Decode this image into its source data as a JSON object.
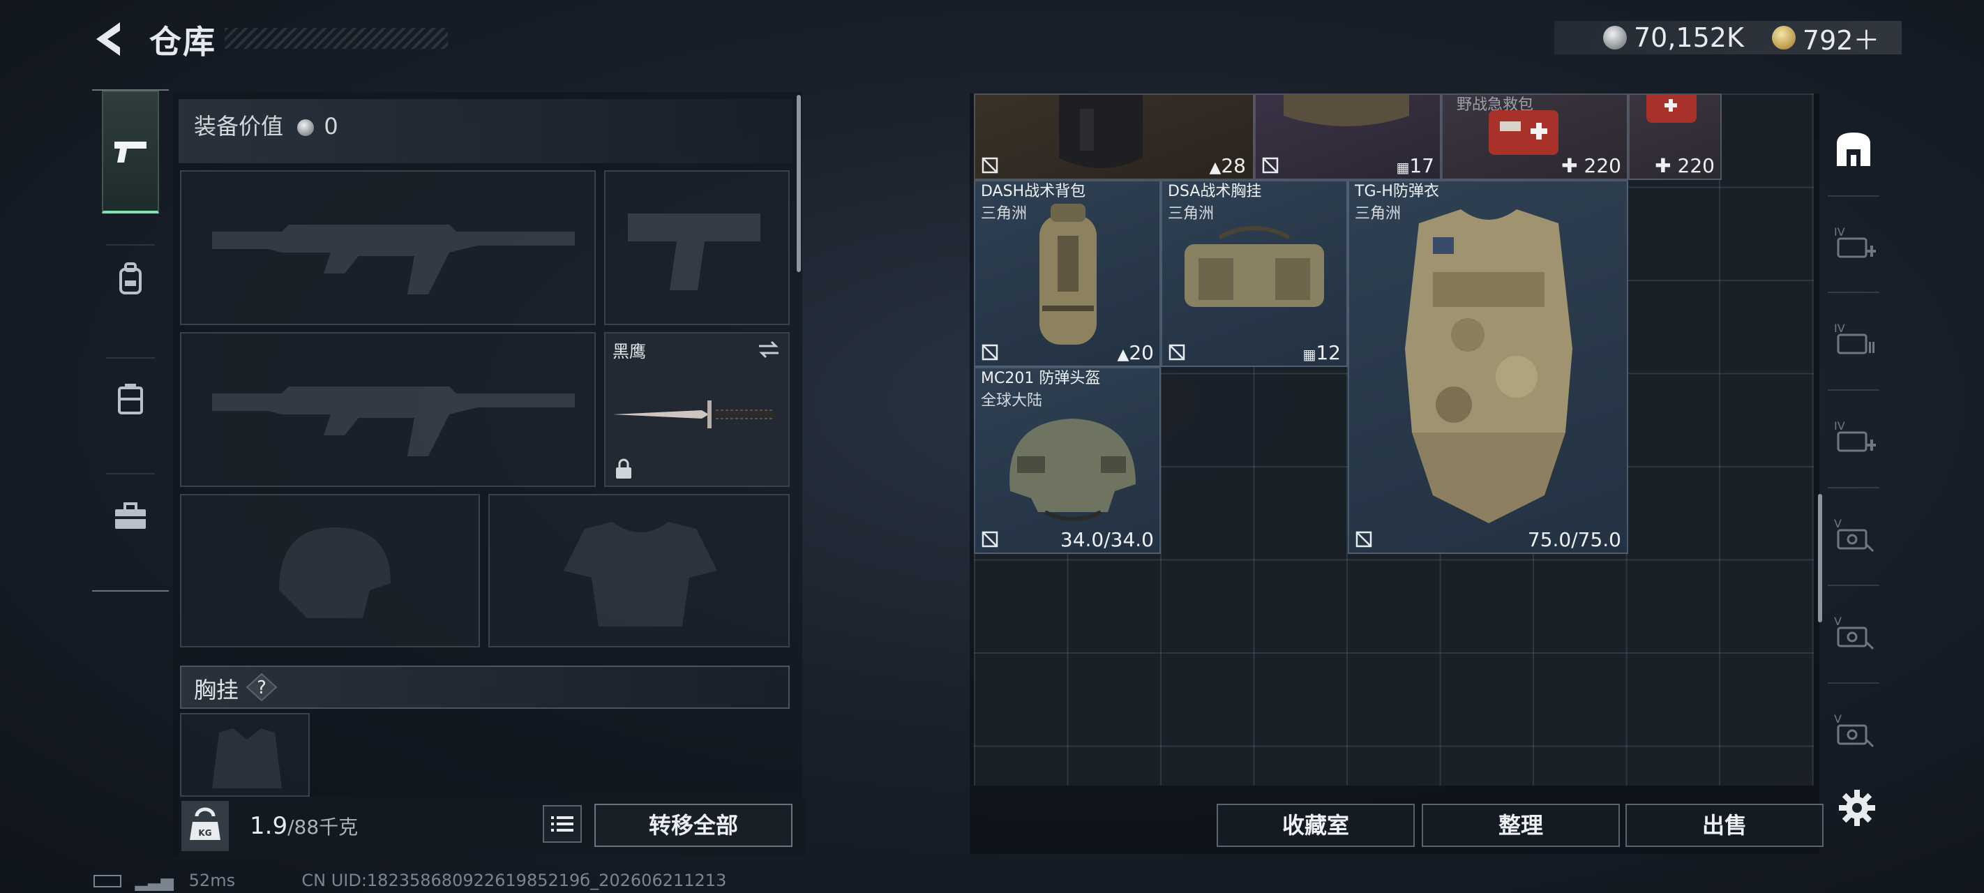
{
  "header": {
    "title": "仓库",
    "currency": [
      {
        "icon": "silver-coin-icon",
        "value": "70,152K"
      },
      {
        "icon": "gold-coin-icon",
        "value": "792＋"
      }
    ]
  },
  "left_tabs": [
    {
      "icon": "pistol-icon",
      "active": true
    },
    {
      "icon": "backpack-icon",
      "active": false
    },
    {
      "icon": "chest-rig-icon",
      "active": false
    },
    {
      "icon": "toolbox-icon",
      "active": false
    }
  ],
  "equipment": {
    "value_label": "装备价值",
    "value": "0",
    "slots": {
      "primary_weapon_1": {
        "icon": "assault-rifle-placeholder-icon"
      },
      "sidearm": {
        "icon": "pistol-placeholder-icon"
      },
      "primary_weapon_2": {
        "icon": "assault-rifle-placeholder-icon"
      },
      "melee": {
        "name": "黑鹰",
        "icon": "knife-icon",
        "locked": true
      },
      "helmet": {
        "icon": "helmet-placeholder-icon"
      },
      "armor": {
        "icon": "armor-placeholder-icon"
      }
    },
    "chest_rig_label": "胸挂",
    "chest_rig_help": "?",
    "weight_current": "1.9",
    "weight_max": "/88千克",
    "transfer_all": "转移全部"
  },
  "stash": {
    "items": [
      {
        "name": "",
        "sub": "",
        "stat": "28",
        "stat_icon": "backpack-small-icon",
        "color": "brown"
      },
      {
        "name": "",
        "sub": "",
        "stat": "17",
        "stat_icon": "vest-small-icon",
        "color": "purple"
      },
      {
        "name": "",
        "sub": "",
        "stat": "220",
        "stat_icon": "plus-icon",
        "color": "red"
      },
      {
        "name": "",
        "sub": "",
        "stat": "220",
        "stat_icon": "plus-icon",
        "color": "red"
      },
      {
        "name": "DASH战术背包",
        "sub": "三角洲",
        "stat": "20",
        "stat_icon": "backpack-small-icon",
        "color": "blue"
      },
      {
        "name": "DSA战术胸挂",
        "sub": "三角洲",
        "stat": "12",
        "stat_icon": "vest-small-icon",
        "color": "blue"
      },
      {
        "name": "TG-H防弹衣",
        "sub": "三角洲",
        "stat": "75.0/75.0",
        "color": "blue"
      },
      {
        "name": "MC201 防弹头盔",
        "sub": "全球大陆",
        "stat": "34.0/34.0",
        "color": "blue"
      }
    ],
    "partial_label": "野战急救包",
    "buttons": {
      "collection": "收藏室",
      "organize": "整理",
      "sell": "出售"
    }
  },
  "right_sidebar": [
    {
      "icon": "stash-home-icon"
    },
    {
      "icon": "expand-stash-iv-icon"
    },
    {
      "icon": "stash-iv-icon"
    },
    {
      "icon": "expand-stash-iv-icon"
    },
    {
      "icon": "stash-v-icon"
    },
    {
      "icon": "stash-v-icon"
    },
    {
      "icon": "stash-v-icon"
    },
    {
      "icon": "settings-gear-icon"
    }
  ],
  "status": {
    "ping": "52ms",
    "uid": "CN UID:18235868092261985219б_202606211213"
  },
  "colors": {
    "accent": "#7fe0b0",
    "item_blue": "#2e4052",
    "item_purple": "#3a3345"
  }
}
